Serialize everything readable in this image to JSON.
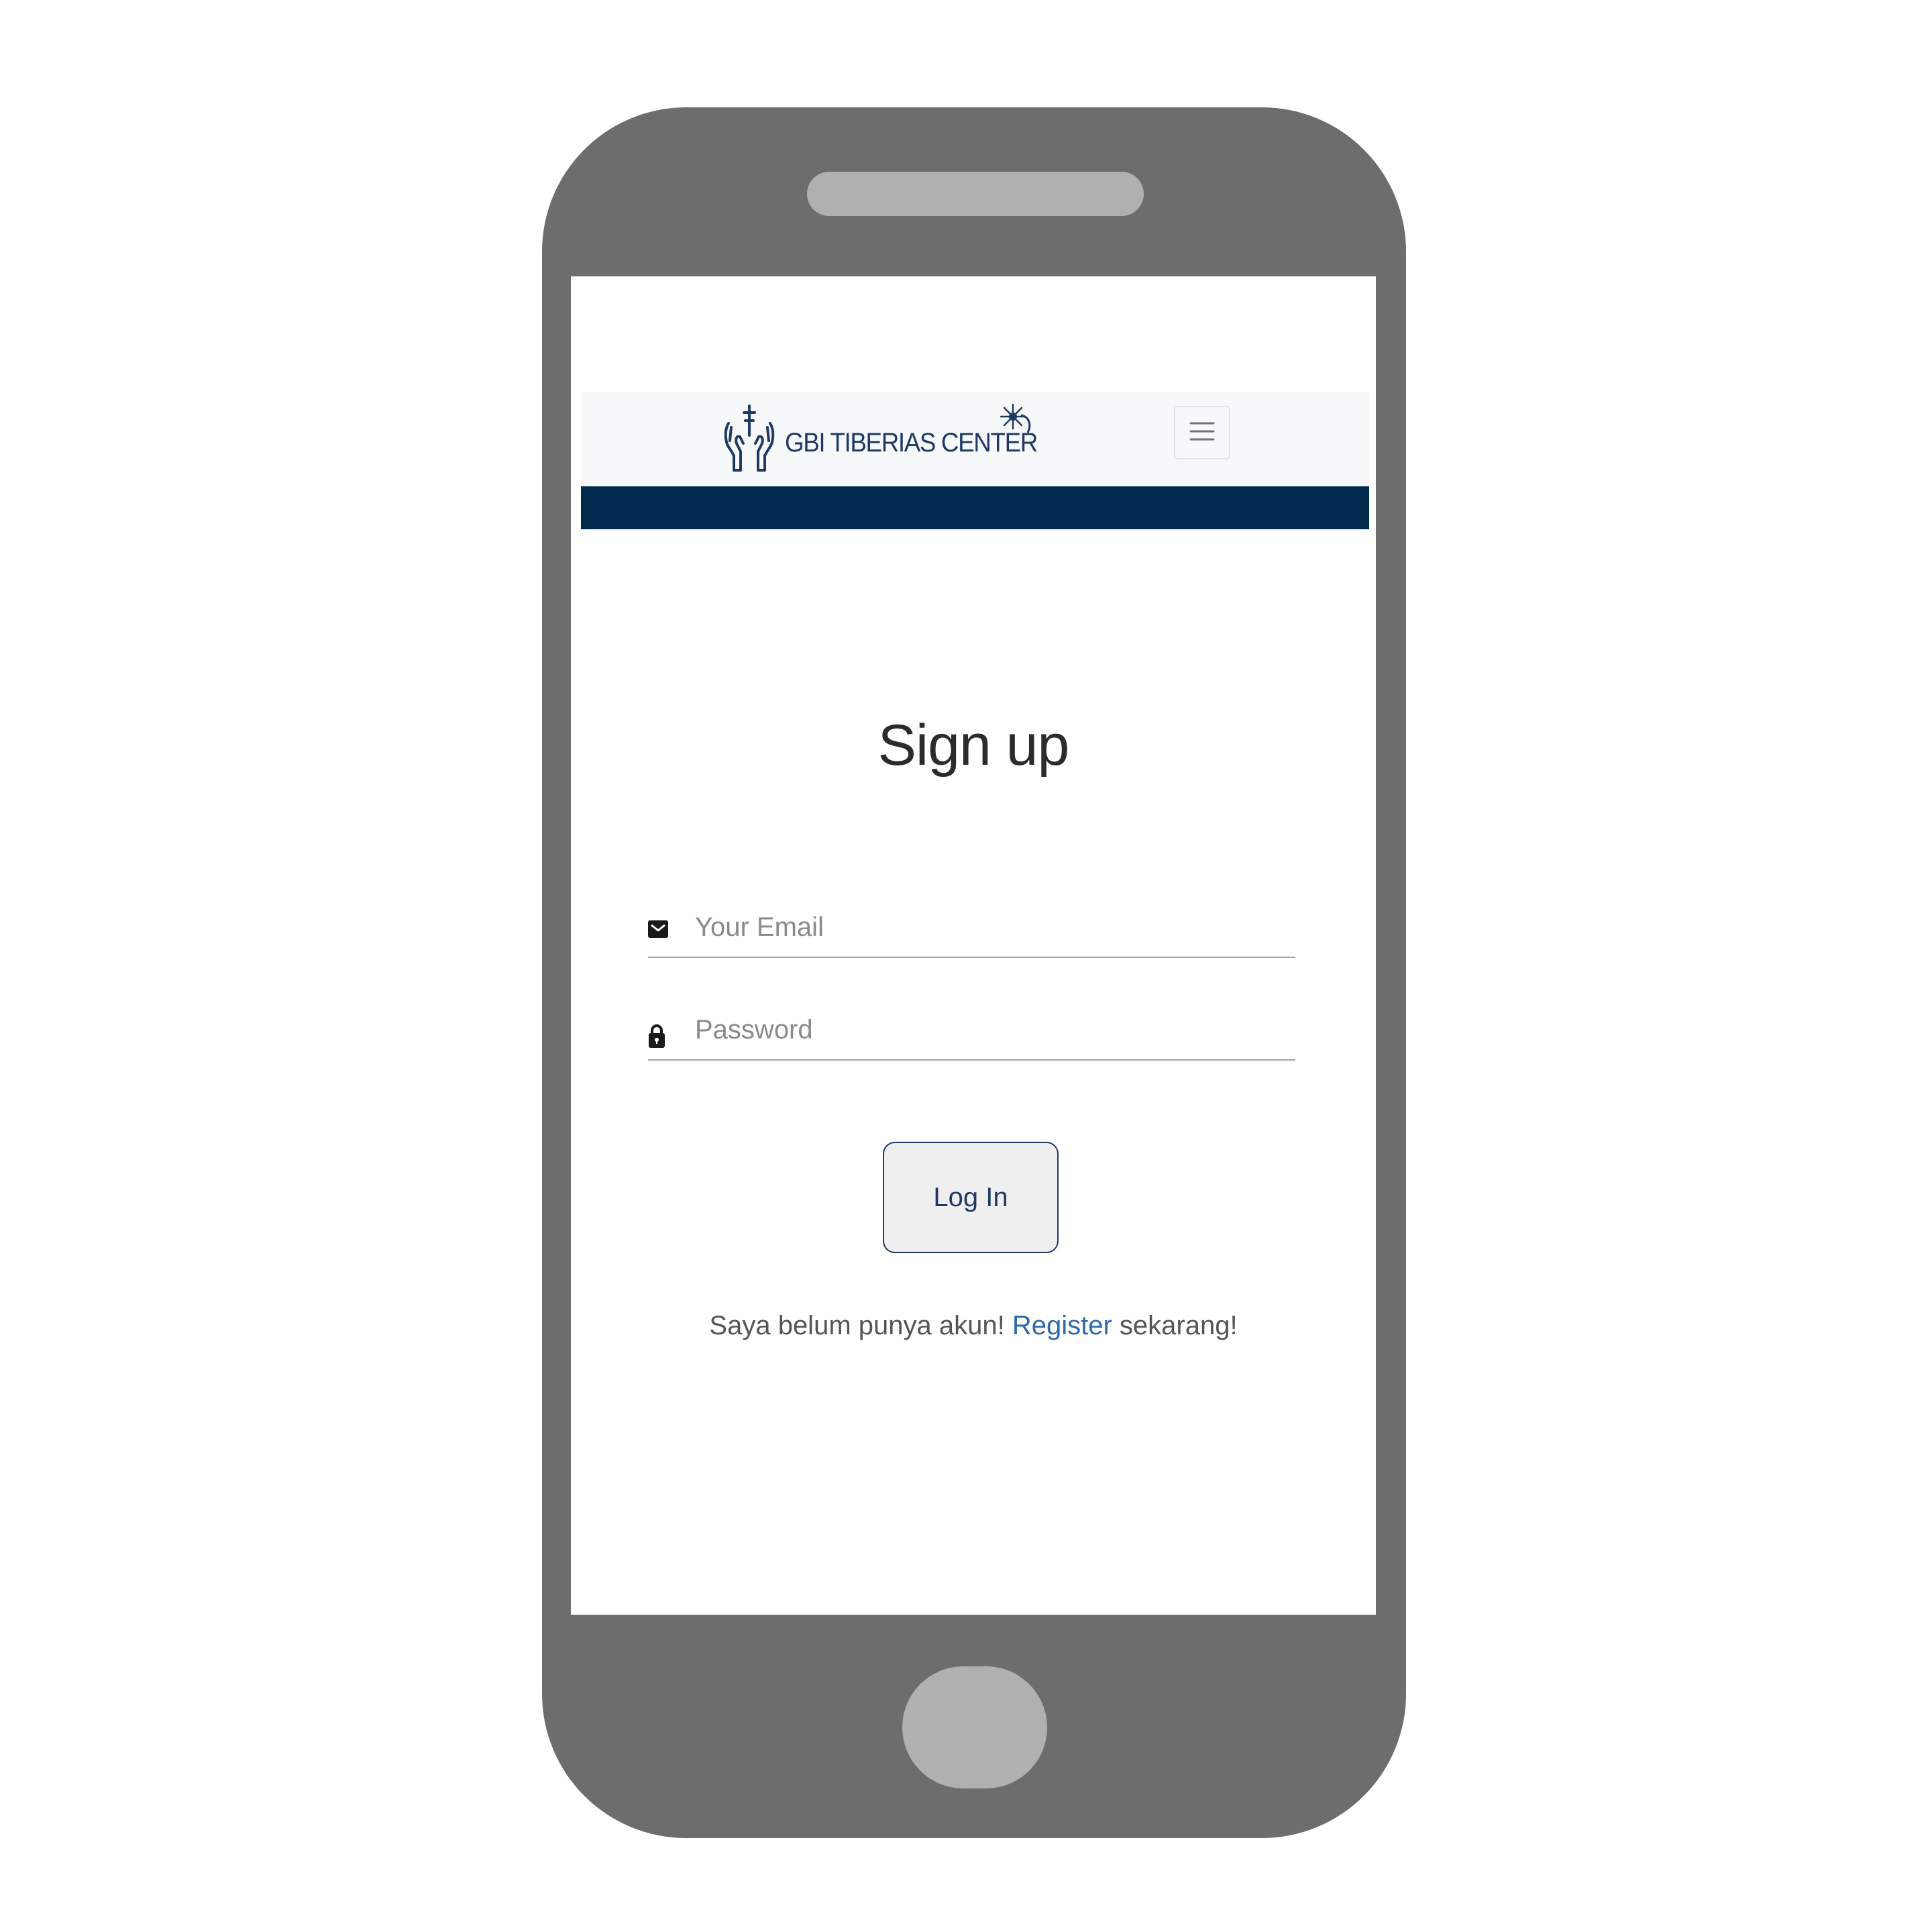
{
  "navbar": {
    "brand_text": "GBI TIBERIAS CENTER",
    "logo_icon": "praying-hands-cross-icon",
    "menu_icon": "hamburger-menu-icon"
  },
  "page": {
    "title": "Sign up"
  },
  "form": {
    "email": {
      "icon": "envelope-icon",
      "placeholder": "Your Email",
      "value": ""
    },
    "password": {
      "icon": "lock-icon",
      "placeholder": "Password",
      "value": ""
    },
    "submit_label": "Log In"
  },
  "footer_text": {
    "prefix": "Saya belum punya akun!",
    "link_label": "Register",
    "suffix": "sekarang!"
  },
  "colors": {
    "brand_navy": "#022a4f",
    "brand_text": "#1f3a64",
    "link": "#2d6aa8",
    "phone_body": "#6d6d6d",
    "phone_buttons": "#b0b0b0"
  }
}
